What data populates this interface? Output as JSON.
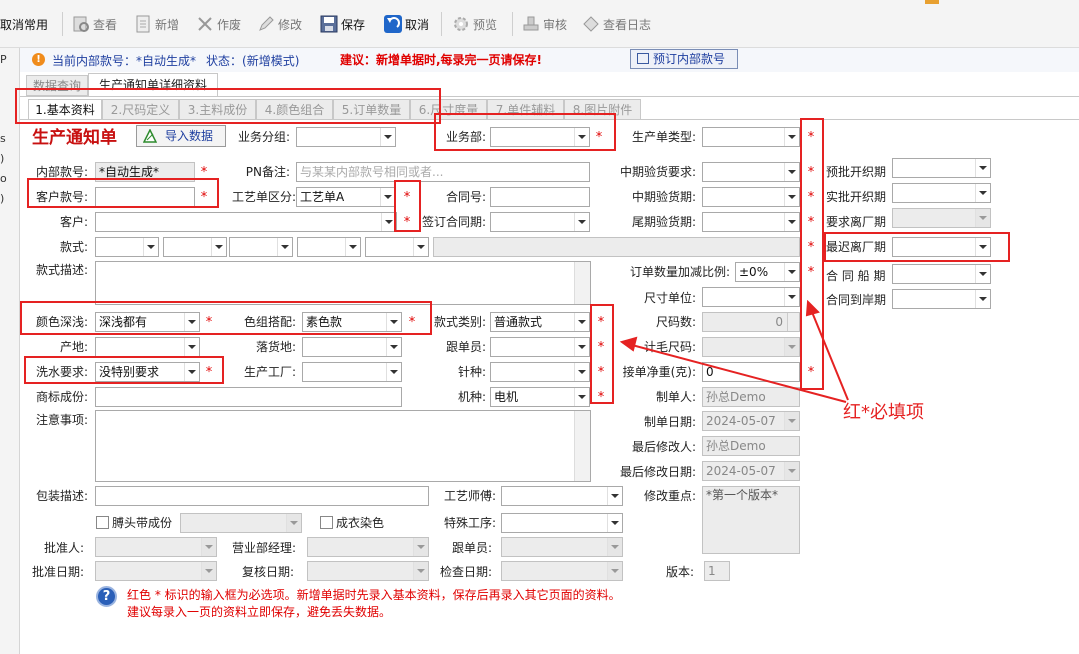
{
  "toolbar": {
    "cancel_common": "取消常用",
    "view": "查看",
    "new": "新增",
    "void": "作废",
    "edit": "修改",
    "save": "保存",
    "cancel": "取消",
    "preview": "预览",
    "review": "审核",
    "view_log": "查看日志"
  },
  "left_strip": {
    "marks": [
      "P",
      "",
      "s",
      ")",
      "o",
      ")"
    ]
  },
  "infobar": {
    "current_no_label": "当前内部款号：",
    "current_no_value": "*自动生成*",
    "status_label": "状态：",
    "status_value": "(新增模式)",
    "advice": "建议：新增单据时,每录完一页请保存!",
    "reserve_button": "预订内部款号"
  },
  "top_tabs": [
    "数据查询",
    "生产通知单详细资料"
  ],
  "sub_tabs": [
    "1.基本资料",
    "2.尺码定义",
    "3.主料成份",
    "4.颜色组合",
    "5.订单数量",
    "6.尺寸度量",
    "7.单件辅料",
    "8.图片附件"
  ],
  "form_title": "生产通知单",
  "import_button": "导入数据",
  "labels": {
    "biz_group": "业务分组:",
    "biz_dept": "业务部:",
    "order_type": "生产单类型:",
    "internal_no": "内部款号:",
    "pn_note": "PN备注:",
    "mid_req": "中期验货要求:",
    "pre_fabric": "预批开织期",
    "customer_no": "客户款号:",
    "process_type": "工艺单区分:",
    "contract_no": "合同号:",
    "mid_date": "中期验货期:",
    "act_fabric": "实批开织期",
    "customer": "客户:",
    "sign_date": "签订合同期:",
    "final_date": "尾期验货期:",
    "req_factory": "要求离厂期",
    "style": "款式:",
    "latest_factory": "最迟离厂期",
    "style_desc": "款式描述:",
    "qty_ratio": "订单数量加减比例:",
    "contract_ship": "合 同 船 期",
    "size_unit": "尺寸单位:",
    "contract_port": "合同到岸期",
    "color_depth": "颜色深浅:",
    "color_match": "色组搭配:",
    "style_cat": "款式类别:",
    "size_count": "尺码数:",
    "origin": "产地:",
    "dest": "落货地:",
    "follower": "跟单员:",
    "measure_size": "计毛尺码:",
    "wash": "洗水要求:",
    "factory": "生产工厂:",
    "needle": "针种:",
    "net_weight": "接单净重(克):",
    "trademark": "商标成份:",
    "machine": "机种:",
    "creator": "制单人:",
    "notes": "注意事项:",
    "create_date": "制单日期:",
    "modifier": "最后修改人:",
    "modify_date": "最后修改日期:",
    "pack_desc": "包装描述:",
    "engineer": "工艺师傅:",
    "change_focus": "修改重点:",
    "label_comp": "膊头带成份",
    "dyed": "成衣染色",
    "special": "特殊工序:",
    "approver": "批准人:",
    "sales_mgr": "营业部经理:",
    "follower2": "跟单员:",
    "approve_date": "批准日期:",
    "recheck_date": "复核日期:",
    "check_date": "检查日期:",
    "version": "版本:"
  },
  "values": {
    "internal_no": "*自动生成*",
    "pn_placeholder": "与某某内部款号相同或者...",
    "process_type": "工艺单A",
    "qty_ratio": "±0%",
    "color_depth": "深浅都有",
    "color_match": "素色款",
    "style_cat": "普通款式",
    "size_count": "0",
    "wash": "没特别要求",
    "machine": "电机",
    "net_weight": "0",
    "creator": "孙总Demo",
    "create_date": "2024-05-07",
    "modifier": "孙总Demo",
    "modify_date": "2024-05-07",
    "change_focus": "*第一个版本*",
    "version": "1"
  },
  "star": "*",
  "annotation": "红*必填项",
  "help": {
    "line1": "红色 * 标识的输入框为必选项。新增单据时先录入基本资料，保存后再录入其它页面的资料。",
    "line2": "建议每录入一页的资料立即保存，避免丢失数据。"
  },
  "colors": {
    "required_red": "#e00000",
    "annotation_red": "#e52222"
  }
}
